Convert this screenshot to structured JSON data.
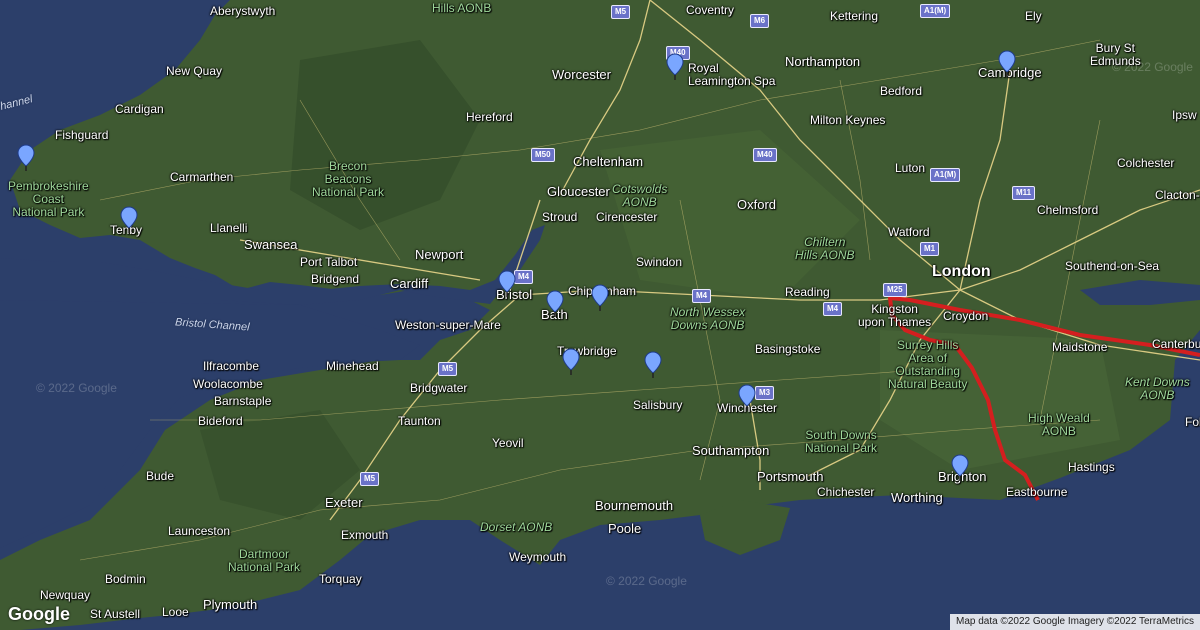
{
  "places": {
    "london": "London",
    "aberystwyth": "Aberystwyth",
    "coventry": "Coventry",
    "kettering": "Kettering",
    "ely": "Ely",
    "new_quay": "New Quay",
    "cardigan": "Cardigan",
    "fishguard": "Fishguard",
    "carmarthen": "Carmarthen",
    "tenby": "Tenby",
    "llanelli": "Llanelli",
    "swansea": "Swansea",
    "port_talbot": "Port Talbot",
    "bridgend": "Bridgend",
    "cardiff": "Cardiff",
    "newport": "Newport",
    "hereford": "Hereford",
    "worcester": "Worcester",
    "royal_leamington_spa": "Royal\nLeamington Spa",
    "northampton": "Northampton",
    "bedford": "Bedford",
    "cambridge": "Cambridge",
    "bury_st_edmunds": "Bury St\nEdmunds",
    "milton_keynes": "Milton Keynes",
    "cheltenham": "Cheltenham",
    "gloucester": "Gloucester",
    "stroud": "Stroud",
    "cirencester": "Cirencester",
    "oxford": "Oxford",
    "luton": "Luton",
    "colchester": "Colchester",
    "clacton": "Clacton-",
    "chelmsford": "Chelmsford",
    "watford": "Watford",
    "swindon": "Swindon",
    "chippenham": "Chippenham",
    "bristol": "Bristol",
    "bath": "Bath",
    "weston_super_mare": "Weston-super-Mare",
    "trowbridge": "Trowbridge",
    "reading": "Reading",
    "kingston": "Kingston\nupon Thames",
    "croydon": "Croydon",
    "southend": "Southend-on-Sea",
    "canterbury": "Canterbury",
    "maidstone": "Maidstone",
    "basingstoke": "Basingstoke",
    "ilfracombe": "Ilfracombe",
    "woolacombe": "Woolacombe",
    "barnstaple": "Barnstaple",
    "minehead": "Minehead",
    "bridgwater": "Bridgwater",
    "bideford": "Bideford",
    "taunton": "Taunton",
    "yeovil": "Yeovil",
    "salisbury": "Salisbury",
    "winchester": "Winchester",
    "southampton": "Southampton",
    "portsmouth": "Portsmouth",
    "chichester": "Chichester",
    "worthing": "Worthing",
    "brighton": "Brighton",
    "eastbourne": "Eastbourne",
    "hastings": "Hastings",
    "folkestone": "Folke",
    "bude": "Bude",
    "exeter": "Exeter",
    "exmouth": "Exmouth",
    "bournemouth": "Bournemouth",
    "poole": "Poole",
    "weymouth": "Weymouth",
    "launceston": "Launceston",
    "torquay": "Torquay",
    "bodmin": "Bodmin",
    "newquay": "Newquay",
    "st_austell": "St Austell",
    "looe": "Looe",
    "plymouth": "Plymouth",
    "ipswich": "Ipsw"
  },
  "parks": {
    "pembrokeshire": "Pembrokeshire\nCoast\nNational Park",
    "brecon": "Brecon\nBeacons\nNational Park",
    "cotswolds": "Cotswolds\nAONB",
    "chiltern": "Chiltern\nHills AONB",
    "north_wessex": "North Wessex\nDowns AONB",
    "surrey_hills": "Surrey Hills\nArea of\nOutstanding\nNatural Beauty",
    "high_weald": "High Weald\nAONB",
    "kent_downs": "Kent Downs\nAONB",
    "south_downs": "South Downs\nNational Park",
    "dorset": "Dorset AONB",
    "dartmoor": "Dartmoor\nNational Park",
    "hills_aonb": "Hills AONB"
  },
  "water": {
    "bristol_channel": "Bristol Channel",
    "channel": "hannel"
  },
  "roads": [
    "M5",
    "M6",
    "A1(M)",
    "M40",
    "M50",
    "M40",
    "A1(M)",
    "M11",
    "M1",
    "M4",
    "M25",
    "M4",
    "M4",
    "M3",
    "M5",
    "M5"
  ],
  "markers": [
    "pin-pembrokeshire",
    "pin-tenby",
    "pin-leamington",
    "pin-cambridge",
    "pin-bristol",
    "pin-bath",
    "pin-chippenham",
    "pin-trowbridge",
    "pin-salisbury-plain",
    "pin-winchester",
    "pin-brighton"
  ],
  "colors": {
    "sea": "#2c3f6a",
    "land": "#3f5a32",
    "route": "#d41f1f",
    "marker": "#7aa6ff",
    "roads": "#e9d68a"
  },
  "watermarks": [
    "© 2022 Google",
    "© 2022 Google",
    "© 2022 Google"
  ],
  "branding": {
    "logo": "Google"
  },
  "attribution": "Map data ©2022 Google Imagery ©2022 TerraMetrics"
}
